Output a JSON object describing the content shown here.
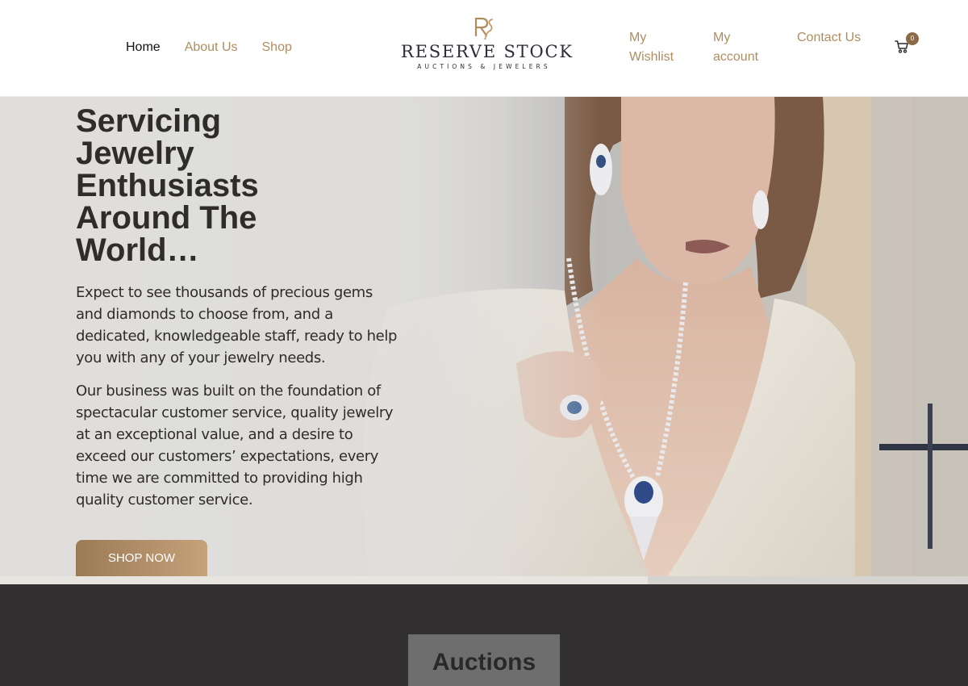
{
  "header": {
    "nav_left": [
      {
        "label": "Home",
        "active": true
      },
      {
        "label": "About Us",
        "active": false
      },
      {
        "label": "Shop",
        "active": false
      }
    ],
    "logo": {
      "name": "RESERVE STOCK",
      "tagline": "AUCTIONS & JEWELERS",
      "monogram": "RS"
    },
    "nav_right": {
      "wishlist": "My Wishlist",
      "account": "My account",
      "contact": "Contact Us"
    },
    "cart": {
      "icon": "cart-icon",
      "count": "0"
    }
  },
  "hero": {
    "title": "Servicing Jewelry Enthusiasts Around The World…",
    "paragraph_1": "Expect to see thousands of precious gems and diamonds to choose from, and a dedicated, knowledgeable staff, ready to help you with any of your jewelry needs.",
    "paragraph_2": "Our business was built on the foundation of spectacular customer service, quality jewelry at an exceptional value, and a desire to exceed our customers’ expectations, every time we are committed to providing high quality customer service.",
    "cta_label": "SHOP NOW"
  },
  "sections": {
    "auctions_label": "Auctions"
  },
  "colors": {
    "accent_gold": "#b08d60",
    "button_gold": "#9b7a55",
    "dark_band": "#323031",
    "text_dark": "#2f2d2c"
  }
}
